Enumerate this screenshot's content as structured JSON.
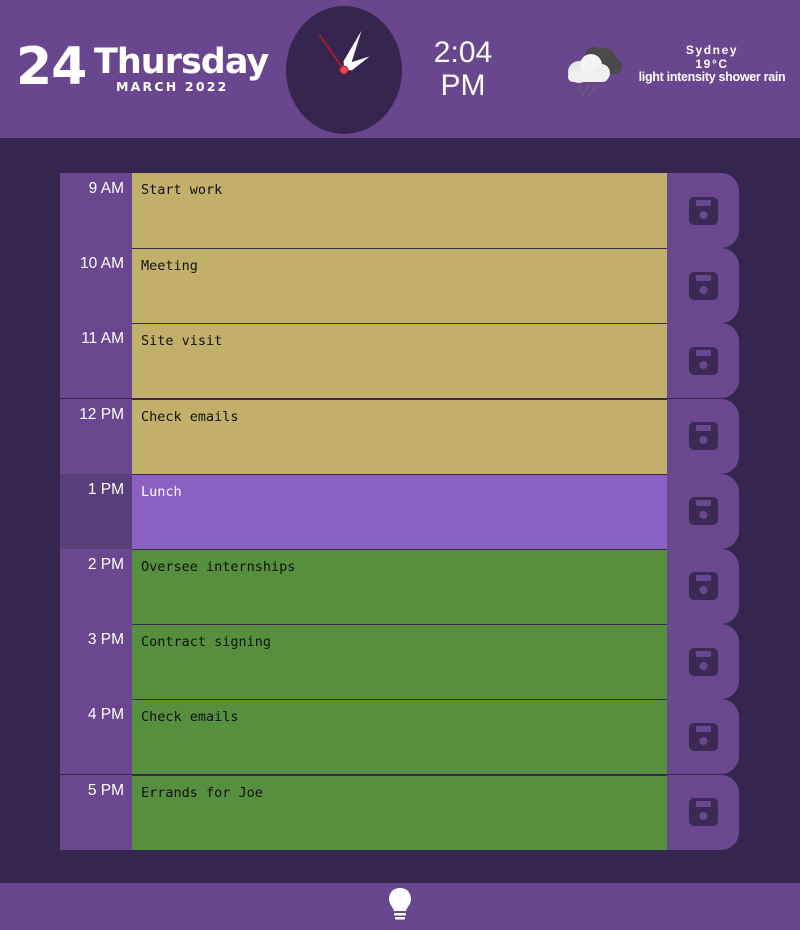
{
  "header": {
    "date_number": "24",
    "weekday": "Thursday",
    "month_year": "MARCH 2022",
    "time_hm": "2:04",
    "time_ampm": "PM",
    "clock_hour_angle": 62,
    "clock_minute_angle": 24,
    "clock_second_angle": -35
  },
  "weather": {
    "icon": "rain-cloud-icon",
    "city": "Sydney",
    "temperature": "19°C",
    "description": "light intensity shower rain"
  },
  "schedule": [
    {
      "hour": "9 AM",
      "task": "Start work",
      "state": "past"
    },
    {
      "hour": "10 AM",
      "task": "Meeting",
      "state": "past"
    },
    {
      "hour": "11 AM",
      "task": "Site visit",
      "state": "past"
    },
    {
      "hour": "12 PM",
      "task": "Check emails",
      "state": "past"
    },
    {
      "hour": "1 PM",
      "task": "Lunch",
      "state": "present"
    },
    {
      "hour": "2 PM",
      "task": "Oversee internships",
      "state": "future"
    },
    {
      "hour": "3 PM",
      "task": "Contract signing",
      "state": "future"
    },
    {
      "hour": "4 PM",
      "task": "Check emails",
      "state": "future"
    },
    {
      "hour": "5 PM",
      "task": "Errands for Joe",
      "state": "future"
    }
  ],
  "colors": {
    "header_bg": "#69478f",
    "page_bg": "#352650",
    "past": "#c2b06a",
    "present": "#8c5fc2",
    "future": "#56903e",
    "save_icon": "#3b2a55"
  },
  "footer": {
    "icon": "lightbulb-icon"
  }
}
